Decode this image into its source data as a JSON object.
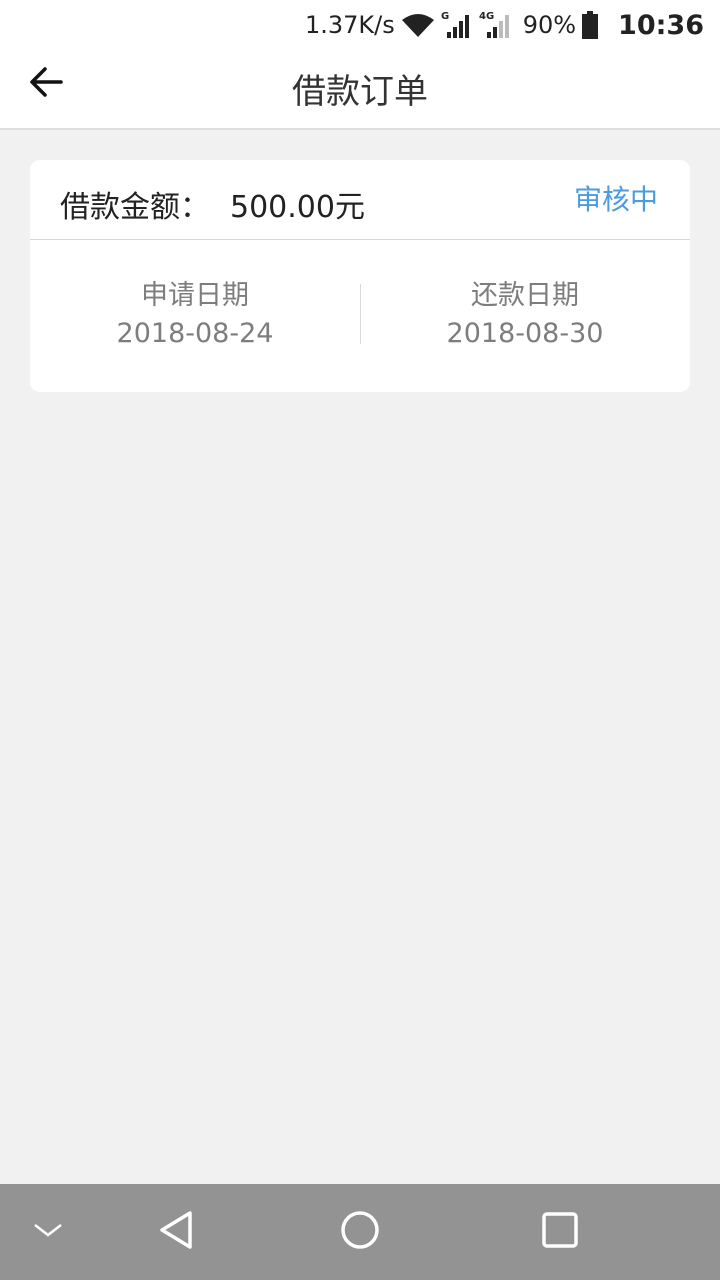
{
  "status_bar": {
    "net_speed": "1.37K/s",
    "sim1_label": "G",
    "sim2_label": "4G",
    "battery": "90%",
    "time": "10:36"
  },
  "header": {
    "title": "借款订单",
    "back_icon": "arrow-left-icon"
  },
  "order": {
    "amount_label": "借款金额：",
    "amount_value": "500.00元",
    "status": "审核中",
    "status_color": "#4b9be0",
    "apply_date_label": "申请日期",
    "apply_date": "2018-08-24",
    "repay_date_label": "还款日期",
    "repay_date": "2018-08-30"
  },
  "nav_bar": {
    "buttons": [
      "chevron-down-icon",
      "back-triangle-icon",
      "home-circle-icon",
      "recents-square-icon"
    ]
  }
}
